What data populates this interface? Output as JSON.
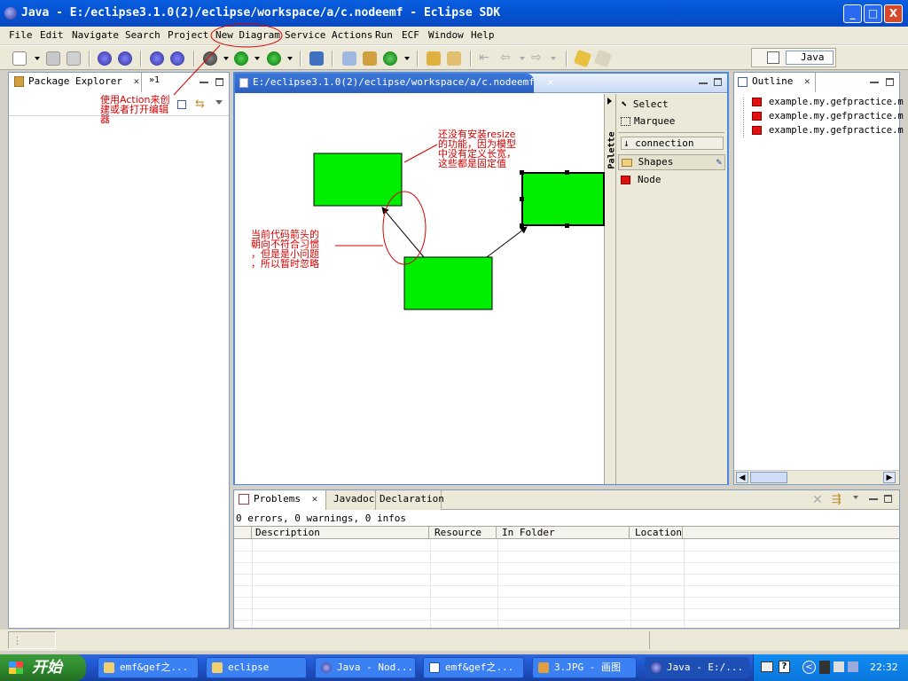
{
  "window": {
    "title": "Java - E:/eclipse3.1.0(2)/eclipse/workspace/a/c.nodeemf - Eclipse SDK",
    "buttons": [
      "_",
      "□",
      "X"
    ]
  },
  "menu": [
    "File",
    "Edit",
    "Navigate",
    "Search",
    "Project",
    "New Diagram",
    "Service Actions",
    "Run",
    "ECF",
    "Window",
    "Help"
  ],
  "perspective": {
    "label": "Java"
  },
  "package_explorer": {
    "tab": "Package Explorer",
    "overflow": "»1"
  },
  "editor": {
    "tab": "E:/eclipse3.1.0(2)/eclipse/workspace/a/c.nodeemf"
  },
  "palette": {
    "title": "Palette",
    "items": [
      "Select",
      "Marquee",
      "connection",
      "Shapes",
      "Node"
    ]
  },
  "outline": {
    "tab": "Outline",
    "items": [
      "example.my.gefpractice.m",
      "example.my.gefpractice.m",
      "example.my.gefpractice.m"
    ]
  },
  "annotations": {
    "action": "使用Action来创\n建或者打开编辑\n器",
    "resize": "还没有安装resize\n的功能，因为模型\n中没有定义长宽，\n这些都是固定值",
    "arrow": "当前代码箭头的\n朝向不符合习惯\n，但是是小问题\n，所以暂时忽略"
  },
  "problems": {
    "tabs": [
      "Problems",
      "Javadoc",
      "Declaration"
    ],
    "summary": "0 errors, 0 warnings, 0 infos",
    "columns": [
      "Description",
      "Resource",
      "In Folder",
      "Location"
    ]
  },
  "taskbar": {
    "start": "开始",
    "tasks": [
      "emf&gef之...",
      "eclipse",
      "Java - Nod...",
      "emf&gef之...",
      "3.JPG - 画图",
      "Java - E:/..."
    ],
    "clock": "22:32"
  },
  "colors": {
    "node_fill": "#00ee00",
    "annotation": "#d80000",
    "titlebar": "#0454d4",
    "taskbar": "#245edb"
  }
}
